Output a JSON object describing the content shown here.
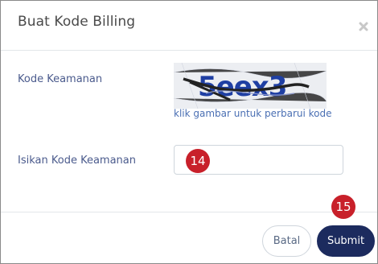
{
  "modal": {
    "title": "Buat Kode Billing",
    "close_icon": "close-icon"
  },
  "form": {
    "security_code_label": "Kode Keamanan",
    "captcha_text": "5eex3",
    "captcha_hint": "klik gambar untuk perbarui kode",
    "input_label": "Isikan Kode Keamanan",
    "input_value": "",
    "input_placeholder": ""
  },
  "markers": {
    "input_step": "14",
    "submit_step": "15",
    "color": "#c8202a"
  },
  "footer": {
    "cancel_label": "Batal",
    "submit_label": "Submit"
  },
  "colors": {
    "primary": "#1c2b5e",
    "label": "#4a5a8c",
    "link": "#4a6fb3"
  }
}
